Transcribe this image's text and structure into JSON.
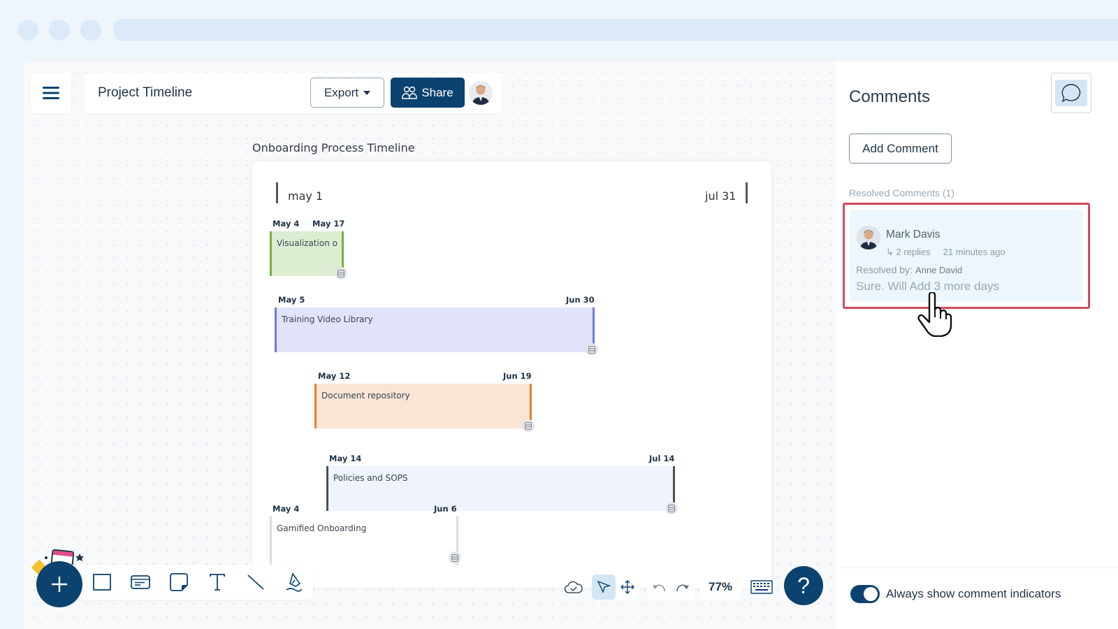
{
  "header": {
    "menu_icon": "hamburger-menu-icon",
    "title": "Project Timeline",
    "export_label": "Export",
    "share_label": "Share",
    "share_icon": "users-icon",
    "user_avatar": "user-avatar"
  },
  "timeline": {
    "title": "Onboarding Process Timeline",
    "start_label": "may 1",
    "end_label": "jul 31",
    "tasks": [
      {
        "name": "Visualization o",
        "start": "May 4",
        "end": "May 17",
        "fill": "#dcedd2",
        "edge": "#73b23e"
      },
      {
        "name": "Training Video Library",
        "start": "May 5",
        "end": "Jun 30",
        "fill": "#e1e3fc",
        "edge": "#6f79e0"
      },
      {
        "name": "Document repository",
        "start": "May 12",
        "end": "Jun 19",
        "fill": "#f9e4d6",
        "edge": "#e08032"
      },
      {
        "name": "Policies and SOPS",
        "start": "May 14",
        "end": "Jul 14",
        "fill": "#eef3fc",
        "edge": "#4a5056"
      },
      {
        "name": "Gamified Onboarding",
        "start": "May 4",
        "end": "Jun 6",
        "fill": "#ffffff",
        "edge": "#dadcde"
      }
    ]
  },
  "toolbar": {
    "add_icon": "plus-icon",
    "tools": [
      "rectangle-icon",
      "card-icon",
      "sticky-note-icon",
      "text-icon",
      "line-icon",
      "pen-icon"
    ],
    "zoom_level": "77%",
    "help_label": "?"
  },
  "comments": {
    "title": "Comments",
    "add_comment_label": "Add Comment",
    "resolved_label": "Resolved Comments (1)",
    "items": [
      {
        "author": "Mark Davis",
        "replies": "↳ 2 replies",
        "time": "21 minutes ago",
        "resolved_by_label": "Resolved by:",
        "resolved_by": "Anne David",
        "body": "Sure. Will Add 3 more days"
      }
    ],
    "toggle_label": "Always show comment indicators",
    "toggle_on": true
  },
  "colors": {
    "primary": "#0b4270",
    "highlight": "#d24a5c"
  }
}
